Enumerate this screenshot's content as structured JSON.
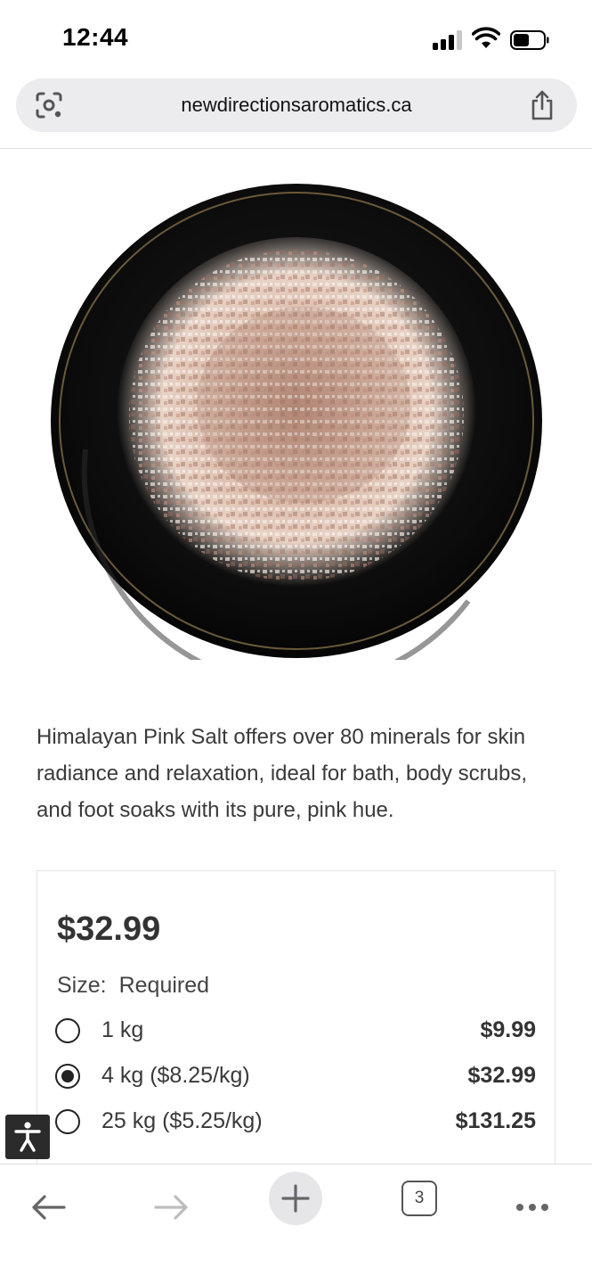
{
  "status_bar": {
    "time": "12:44"
  },
  "browser": {
    "url": "newdirectionsaromatics.ca",
    "tab_count": "3"
  },
  "product": {
    "image_alt": "Himalayan pink salt crystals on a black plate",
    "description": "Himalayan Pink Salt offers over 80 minerals for skin radiance and relaxation, ideal for bath, body scrubs, and foot soaks with its pure, pink hue.",
    "price": "$32.99",
    "size_label": "Size:",
    "size_required": "Required",
    "options": [
      {
        "label": "1 kg",
        "price": "$9.99",
        "selected": false
      },
      {
        "label": "4 kg ($8.25/kg)",
        "price": "$32.99",
        "selected": true
      },
      {
        "label": "25 kg ($5.25/kg)",
        "price": "$131.25",
        "selected": false
      }
    ]
  },
  "colors": {
    "toolbar_icon": "#666666",
    "text": "#3a3a3a",
    "plate": "#0f0f0f",
    "plate_rim": "#6b5a3a"
  },
  "icons": {
    "lens": "lens-icon",
    "share": "share-icon",
    "back": "back-arrow-icon",
    "forward": "forward-arrow-icon",
    "new_tab": "plus-icon",
    "more": "more-icon",
    "accessibility": "accessibility-icon"
  }
}
